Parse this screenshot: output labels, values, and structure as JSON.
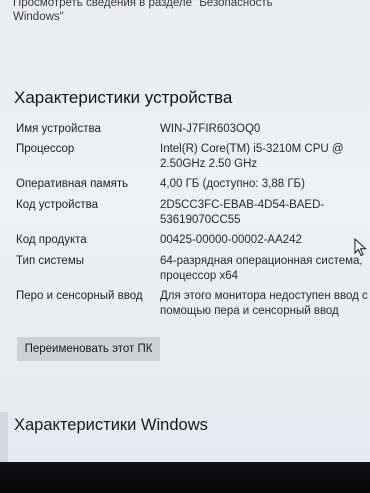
{
  "header": {
    "note_line1": "Просмотреть сведения в разделе \"Безопасность",
    "note_line2": "Windows\""
  },
  "device_specs": {
    "title": "Характеристики устройства",
    "rows": [
      {
        "label": "Имя устройства",
        "value": "WIN-J7FIR603OQ0"
      },
      {
        "label": "Процессор",
        "value": "Intel(R) Core(TM) i5-3210M CPU @ 2.50GHz  2.50 GHz"
      },
      {
        "label": "Оперативная память",
        "value": "4,00 ГБ (доступно: 3,88 ГБ)"
      },
      {
        "label": "Код устройства",
        "value": "2D5CC3FC-EBAB-4D54-BAED-53619070CC55"
      },
      {
        "label": "Код продукта",
        "value": "00425-00000-00002-AA242"
      },
      {
        "label": "Тип системы",
        "value": "64-разрядная операционная система, процессор x64"
      },
      {
        "label": "Перо и сенсорный ввод",
        "value": "Для этого монитора недоступен ввод с помощью пера и сенсорный ввод"
      }
    ],
    "rename_button": "Переименовать этот ПК"
  },
  "windows_specs": {
    "title": "Характеристики Windows"
  },
  "colors": {
    "background": "#eef0f6",
    "button": "#cfd1d8",
    "taskbar": "#0b0b0c"
  },
  "icons": {
    "cursor": "mouse-pointer-icon"
  }
}
